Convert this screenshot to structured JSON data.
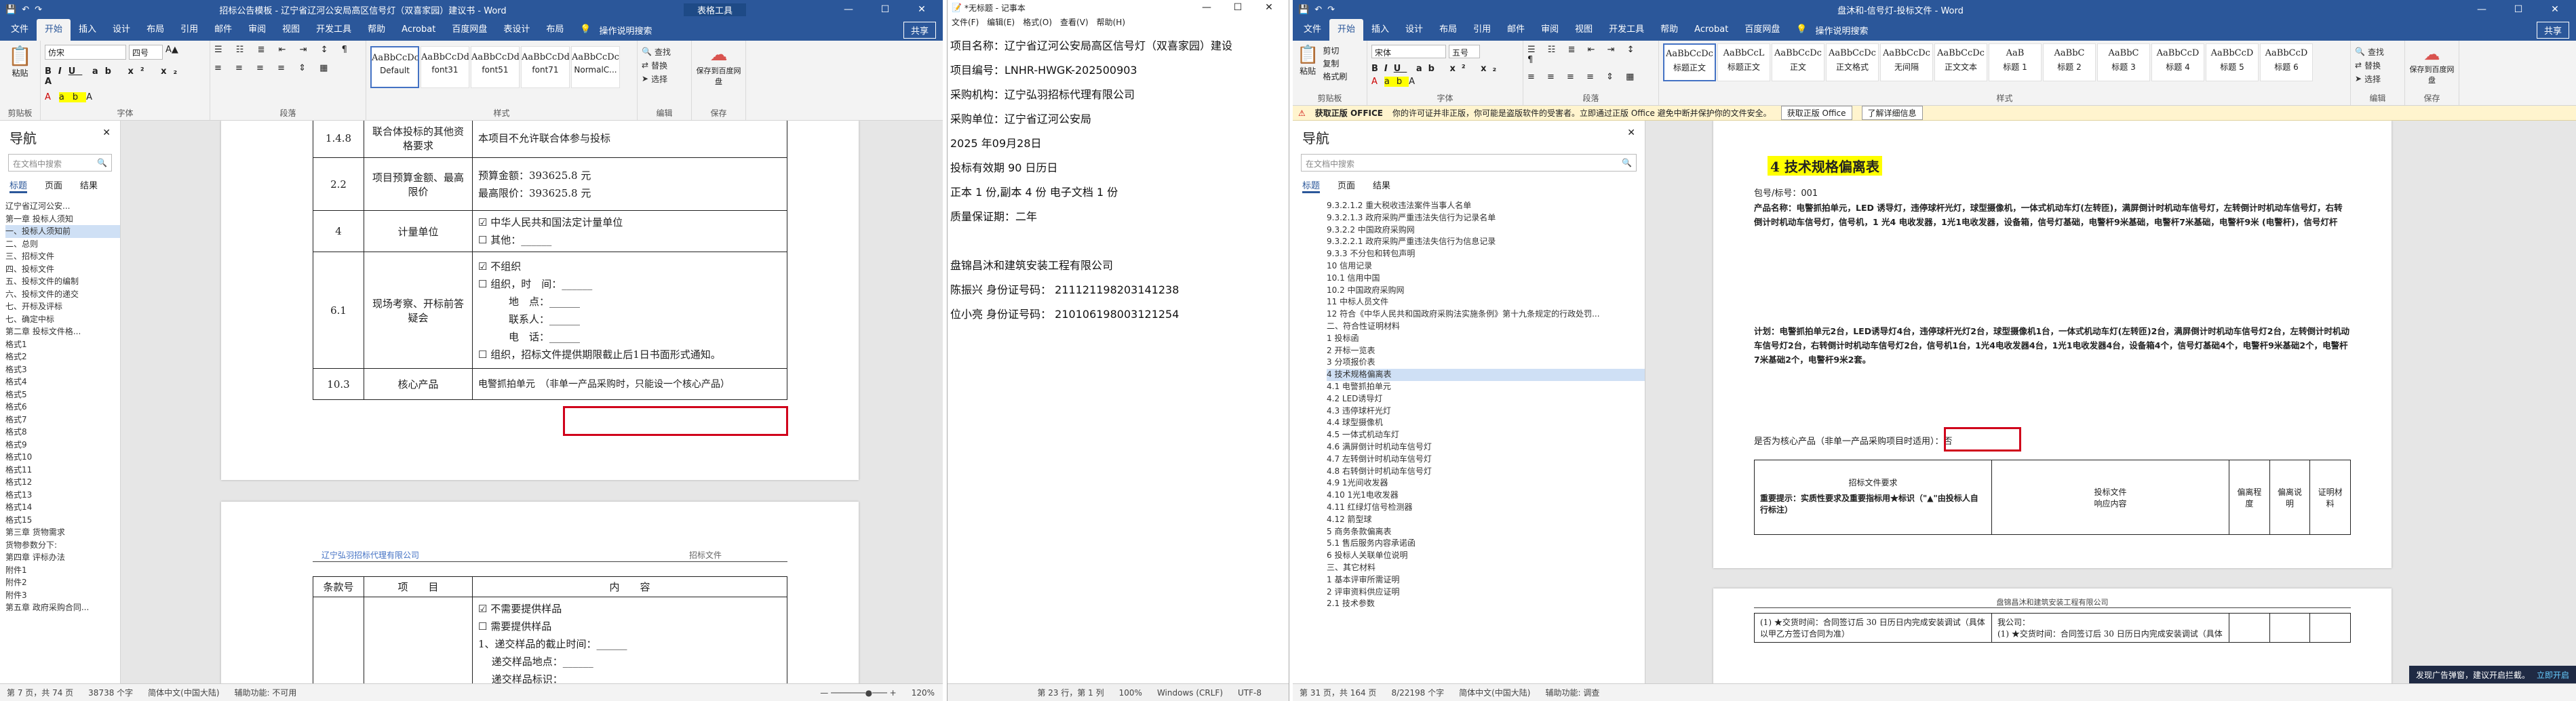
{
  "left_word": {
    "title": "招标公告模板 - 辽宁省辽河公安局高区信号灯（双喜家园）建议书 - Word",
    "table_tools": "表格工具",
    "share": "共享",
    "tabs": [
      "文件",
      "开始",
      "插入",
      "设计",
      "布局",
      "引用",
      "邮件",
      "审阅",
      "视图",
      "开发工具",
      "帮助",
      "Acrobat",
      "百度网盘",
      "表设计",
      "布局"
    ],
    "tell_me": "操作说明搜索",
    "ribbon": {
      "paste": "粘贴",
      "clipboard": "剪贴板",
      "font_name": "仿宋",
      "font_size": "四号",
      "font_group": "字体",
      "para_group": "段落",
      "styles_group": "样式",
      "edit_group": "编辑",
      "styles": [
        {
          "prev": "AaBbCcDc",
          "name": "Default"
        },
        {
          "prev": "AaBbCcDd",
          "name": "font31"
        },
        {
          "prev": "AaBbCcDd",
          "name": "font51"
        },
        {
          "prev": "AaBbCcDd",
          "name": "font71"
        },
        {
          "prev": "AaBbCcDc",
          "name": "NormalC..."
        }
      ],
      "find": "查找",
      "replace": "替换",
      "select": "选择",
      "save_baidu": "保存到百度网盘",
      "save_group": "保存"
    },
    "nav": {
      "title": "导航",
      "search_placeholder": "在文档中搜索",
      "tabs": [
        "标题",
        "页面",
        "结果"
      ],
      "items": [
        "辽宁省辽河公安...",
        "第一章 投标人须知",
        "一、投标人须知前",
        "二、总则",
        "三、招标文件",
        "四、投标文件",
        "五、投标文件的编制",
        "六、投标文件的递交",
        "七、开标及评标",
        "七、确定中标",
        "第二章 投标文件格...",
        "格式1",
        "格式2",
        "格式3",
        "格式4",
        "格式5",
        "格式6",
        "格式7",
        "格式8",
        "格式9",
        "格式10",
        "格式11",
        "格式12",
        "格式13",
        "格式14",
        "格式15",
        "第三章 货物需求",
        "货物参数分下:",
        "第四章 评标办法",
        "附件1",
        "附件2",
        "附件3",
        "第五章 政府采购合同..."
      ],
      "selected_index": 2
    },
    "table1": {
      "rows": [
        {
          "num": "1.4.8",
          "label": "联合体投标的其他资格要求",
          "content": "本项目不允许联合体参与投标"
        },
        {
          "num": "2.2",
          "label": "项目预算金额、最高限价",
          "content": "预算金额：393625.8 元\n最高限价：393625.8 元"
        },
        {
          "num": "4",
          "label": "计量单位",
          "content": "☑ 中华人民共和国法定计量单位\n☐ 其他：______"
        },
        {
          "num": "6.1",
          "label": "现场考察、开标前答疑会",
          "content": "☑ 不组织\n☐ 组织，时　间：______\n　　　地　点：______\n　　　联系人：______\n　　　电　话：______\n☐ 组织，招标文件提供期限截止后1日书面形式通知。"
        },
        {
          "num": "10.3",
          "label": "核心产品",
          "content": "电警抓拍单元　（非单一产品采购时，只能设一个核心产品）"
        }
      ]
    },
    "page2_header_left": "辽宁弘羽招标代理有限公司",
    "page2_header_right": "招标文件",
    "table2": {
      "headers": [
        "条款号",
        "项　　目",
        "内　　容"
      ],
      "lines": [
        "☑ 不需要提供样品",
        "☐ 需要提供样品",
        "1、递交样品的截止时间：______",
        "　 递交样品地点：______",
        "　 递交样品标识：______"
      ]
    },
    "status": [
      "第 7 页，共 74 页",
      "38738 个字",
      "简体中文(中国大陆)",
      "辅助功能: 不可用"
    ],
    "zoom": "120%"
  },
  "notepad": {
    "title": "*无标题 - 记事本",
    "menu": [
      "文件(F)",
      "编辑(E)",
      "格式(O)",
      "查看(V)",
      "帮助(H)"
    ],
    "lines": [
      "项目名称：辽宁省辽河公安局高区信号灯（双喜家园）建设",
      "项目编号：LNHR-HWGK-202500903",
      "采购机构：辽宁弘羽招标代理有限公司",
      "采购单位：辽宁省辽河公安局",
      "2025 年09月28日",
      "投标有效期 90 日历日",
      "正本 1 份,副本 4 份  电子文档 1 份",
      "质量保证期：二年",
      "",
      "盘锦昌沐和建筑安装工程有限公司",
      "陈振兴  身份证号码：  211121198203141238",
      "位小亮  身份证号码：  210106198003121254"
    ],
    "status": [
      "第 23 行，第 1 列",
      "100%",
      "Windows (CRLF)",
      "UTF-8"
    ]
  },
  "right_word": {
    "title": "盘沐和-信号灯-投标文件 - Word",
    "share": "共享",
    "tabs": [
      "文件",
      "开始",
      "插入",
      "设计",
      "布局",
      "引用",
      "邮件",
      "审阅",
      "视图",
      "开发工具",
      "帮助",
      "Acrobat",
      "百度网盘"
    ],
    "tell_me": "操作说明搜索",
    "ribbon": {
      "paste": "粘贴",
      "clipboard": "剪贴板",
      "cut": "剪切",
      "copy": "复制",
      "format_painter": "格式刷",
      "font_name": "宋体",
      "font_size": "五号",
      "font_group": "字体",
      "para_group": "段落",
      "styles_group": "样式",
      "edit_group": "编辑",
      "styles": [
        {
          "prev": "AaBbCcDc",
          "name": "标题正文"
        },
        {
          "prev": "AaBbCcL",
          "name": "标题正文"
        },
        {
          "prev": "AaBbCcDc",
          "name": "正文"
        },
        {
          "prev": "AaBbCcDc",
          "name": "正文格式"
        },
        {
          "prev": "AaBbCcDc",
          "name": "无间隔"
        },
        {
          "prev": "AaBbCcDc",
          "name": "正文文本"
        },
        {
          "prev": "AaB",
          "name": "标题 1"
        },
        {
          "prev": "AaBbC",
          "name": "标题 2"
        },
        {
          "prev": "AaBbC",
          "name": "标题 3"
        },
        {
          "prev": "AaBbCcD",
          "name": "标题 4"
        },
        {
          "prev": "AaBbCcD",
          "name": "标题 5"
        },
        {
          "prev": "AaBbCcD",
          "name": "标题 6"
        }
      ],
      "find": "查找",
      "replace": "替换",
      "select": "选择",
      "save_baidu": "保存到百度网盘",
      "save_group": "保存"
    },
    "infobar": {
      "label": "获取正版 OFFICE",
      "message": "你的许可证并非正版，你可能是盗版软件的受害者。立即通过正版 Office 避免中断并保护你的文件安全。",
      "btn1": "获取正版 Office",
      "btn2": "了解详细信息"
    },
    "nav": {
      "title": "导航",
      "search_placeholder": "在文档中搜索",
      "tabs": [
        "标题",
        "页面",
        "结果"
      ],
      "items": [
        "9.3.2.1.2 重大税收违法案件当事人名单",
        "9.3.2.1.3 政府采购严重违法失信行为记录名单",
        "9.3.2.2 中国政府采购网",
        "9.3.2.2.1 政府采购严重违法失信行为信息记录",
        "9.3.3 不分包和转包声明",
        "10 信用记录",
        "10.1 信用中国",
        "10.2 中国政府采购网",
        "11 中标人员文件",
        "12 符合《中华人民共和国政府采购法实施条例》第十九条规定的行政处罚...",
        "二、符合性证明材料",
        "1 投标函",
        "2 开标一览表",
        "3 分项报价表",
        "4 技术规格偏离表",
        "4.1 电警抓拍单元",
        "4.2 LED诱导灯",
        "4.3 违停球杆光灯",
        "4.4 球型摄像机",
        "4.5 一体式机动车灯",
        "4.6 满屏倒计时机动车信号灯",
        "4.7 左转倒计时机动车信号灯",
        "4.8 右转倒计时机动车信号灯",
        "4.9 1光间收发器",
        "4.10 1光1电收发器",
        "4.11 红绿灯信号检测器",
        "4.12 箭型球",
        "5 商务条款偏离表",
        "5.1 售后服务内容承诺函",
        "6 投标人关联单位说明",
        "三、其它材料",
        "1 基本评审所需证明",
        "2 评审资料供应证明",
        "2.1 技术参数"
      ],
      "selected_index": 14
    },
    "doc": {
      "heading": "4  技术规格偏离表",
      "pkg": "包号/标号：001",
      "para1": "产品名称：电警抓拍单元，LED 诱导灯，违停球杆光灯，球型摄像机，一体式机动车灯(左转匝)，满屏倒计时机动车信号灯，左转倒计时机动车信号灯，右转倒计时机动车信号灯，信号机，1 光4 电收发器，1光1电收发器，设备箱，信号灯基础，电警杆9米基础，电警杆7米基础，电警杆9米 (电警杆)，信号灯杆",
      "para2": "计划：电警抓拍单元2台，LED诱导灯4台，违停球杆光灯2台，球型摄像机1台，一体式机动车灯(左转匝)2台，满屏倒计时机动车信号灯2台，左转倒计时机动车信号灯2台，右转倒计时机动车信号灯2台，信号机1台，1光4电收发器4台，1光1电收发器4台，设备箱4个，信号灯基础4个，电警杆9米基础2个，电警杆7米基础2个，电警杆9米2套。",
      "core_q": "是否为核心产品（非单一产品采购项目时适用）：否",
      "table_headers": [
        "招标文件要求",
        "投标文件\n响应内容",
        "偏离程度",
        "偏离说明",
        "证明材料"
      ],
      "note": "重要提示：实质性要求及重要指标用★标识（\"▲\"由投标人自行标注）",
      "page2_header": "盘锦昌沐和建筑安装工程有限公司",
      "rows": [
        "(1) ★交货时间：合同签订后 30 日历日内完成安装调试（具体以甲乙方签订合同为准）",
        "我公司：",
        "(1) ★交货时间：合同签订后 30 日历日内完成安装调试（具体"
      ]
    },
    "status": [
      "第 31 页，共 164 页",
      "8/22198 个字",
      "简体中文(中国大陆)",
      "辅助功能: 调查"
    ],
    "toast": "发现广告弹窗，建议开启拦截。",
    "toast_btn": "立即开启"
  }
}
